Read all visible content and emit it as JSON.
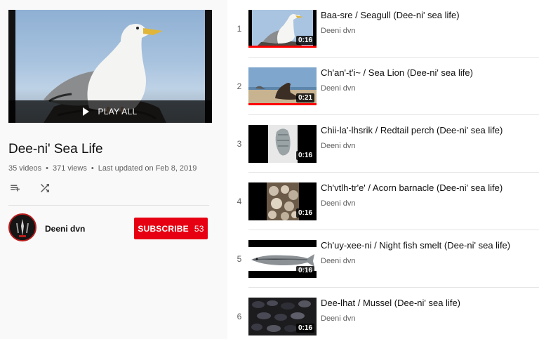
{
  "playlist": {
    "title": "Dee-ni' Sea Life",
    "video_count": "35 videos",
    "views": "371 views",
    "updated": "Last updated on Feb 8, 2019",
    "play_all_label": "PLAY ALL",
    "owner": "Deeni dvn",
    "subscribe_label": "SUBSCRIBE",
    "subscriber_count": "53"
  },
  "icons": {
    "add_to_queue": "playlist-add-icon",
    "shuffle": "shuffle-icon",
    "play": "play-icon"
  },
  "colors": {
    "subscribe_bg": "#e60012",
    "progress": "#ff0000"
  },
  "videos": [
    {
      "index": "1",
      "title": "Baa-sre / Seagull (Dee-ni' sea life)",
      "channel": "Deeni dvn",
      "duration": "0:16",
      "watched": true
    },
    {
      "index": "2",
      "title": "Ch'an'-t'i~ / Sea Lion (Dee-ni' sea life)",
      "channel": "Deeni dvn",
      "duration": "0:21",
      "watched": true
    },
    {
      "index": "3",
      "title": "Chii-la'-lhsrik / Redtail perch (Dee-ni' sea life)",
      "channel": "Deeni dvn",
      "duration": "0:16",
      "watched": false
    },
    {
      "index": "4",
      "title": "Ch'vtlh-tr'e' / Acorn barnacle (Dee-ni' sea life)",
      "channel": "Deeni dvn",
      "duration": "0:16",
      "watched": false
    },
    {
      "index": "5",
      "title": "Ch'uy-xee-ni / Night fish smelt (Dee-ni' sea life)",
      "channel": "Deeni dvn",
      "duration": "0:16",
      "watched": false
    },
    {
      "index": "6",
      "title": "Dee-lhat / Mussel (Dee-ni' sea life)",
      "channel": "Deeni dvn",
      "duration": "0:16",
      "watched": false
    }
  ]
}
